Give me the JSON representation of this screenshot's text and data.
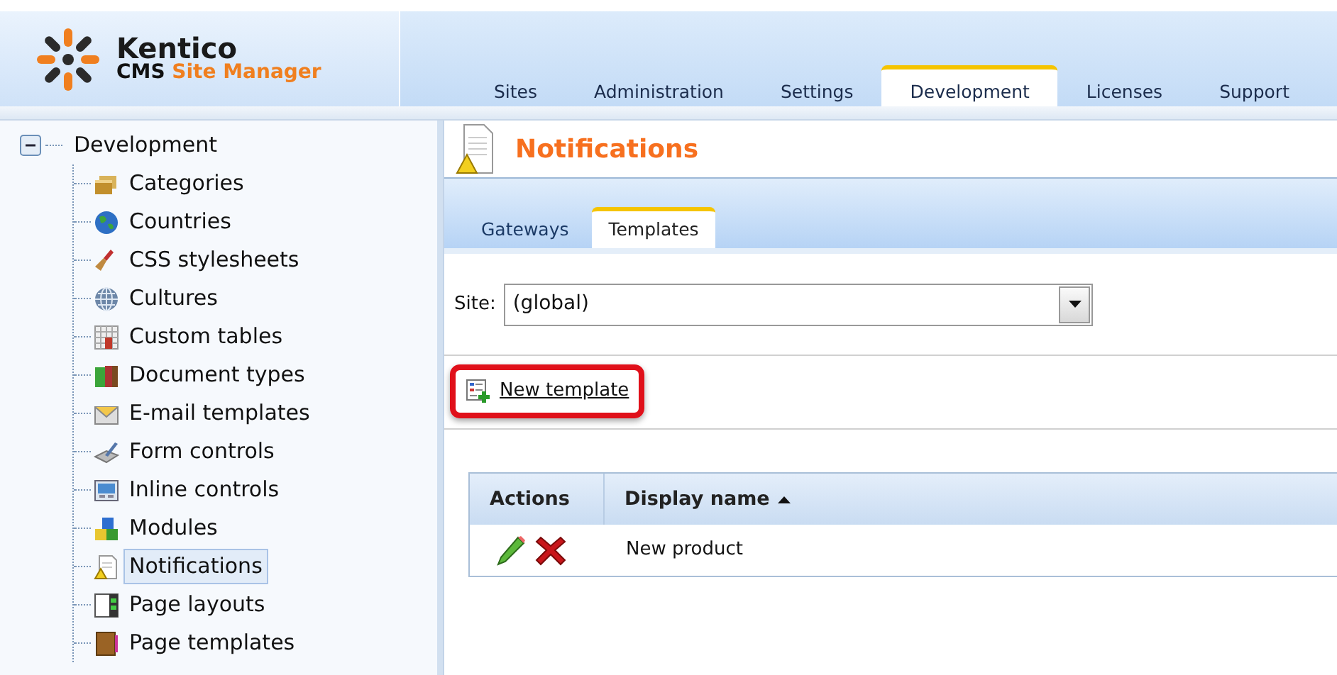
{
  "logo": {
    "name": "Kentico",
    "prefix": "CMS",
    "product": "Site Manager"
  },
  "main_tabs": [
    {
      "label": "Sites",
      "selected": false
    },
    {
      "label": "Administration",
      "selected": false
    },
    {
      "label": "Settings",
      "selected": false
    },
    {
      "label": "Development",
      "selected": true
    },
    {
      "label": "Licenses",
      "selected": false
    },
    {
      "label": "Support",
      "selected": false
    }
  ],
  "tree": {
    "label": "Development",
    "expanded": true,
    "selected": false,
    "children": [
      {
        "label": "Categories",
        "selected": false
      },
      {
        "label": "Countries",
        "selected": false
      },
      {
        "label": "CSS stylesheets",
        "selected": false
      },
      {
        "label": "Cultures",
        "selected": false
      },
      {
        "label": "Custom tables",
        "selected": false
      },
      {
        "label": "Document types",
        "selected": false
      },
      {
        "label": "E-mail templates",
        "selected": false
      },
      {
        "label": "Form controls",
        "selected": false
      },
      {
        "label": "Inline controls",
        "selected": false
      },
      {
        "label": "Modules",
        "selected": false
      },
      {
        "label": "Notifications",
        "selected": true
      },
      {
        "label": "Page layouts",
        "selected": false
      },
      {
        "label": "Page templates",
        "selected": false
      }
    ]
  },
  "page_title": "Notifications",
  "sub_tabs": [
    {
      "label": "Gateways",
      "selected": false
    },
    {
      "label": "Templates",
      "selected": true
    }
  ],
  "site_filter": {
    "label": "Site:",
    "value": "(global)"
  },
  "new_action": {
    "label": "New template",
    "highlighted": true
  },
  "table": {
    "columns": [
      {
        "label": "Actions",
        "sorted": false
      },
      {
        "label": "Display name",
        "sorted": true
      }
    ],
    "rows": [
      {
        "display_name": "New product"
      }
    ]
  }
}
